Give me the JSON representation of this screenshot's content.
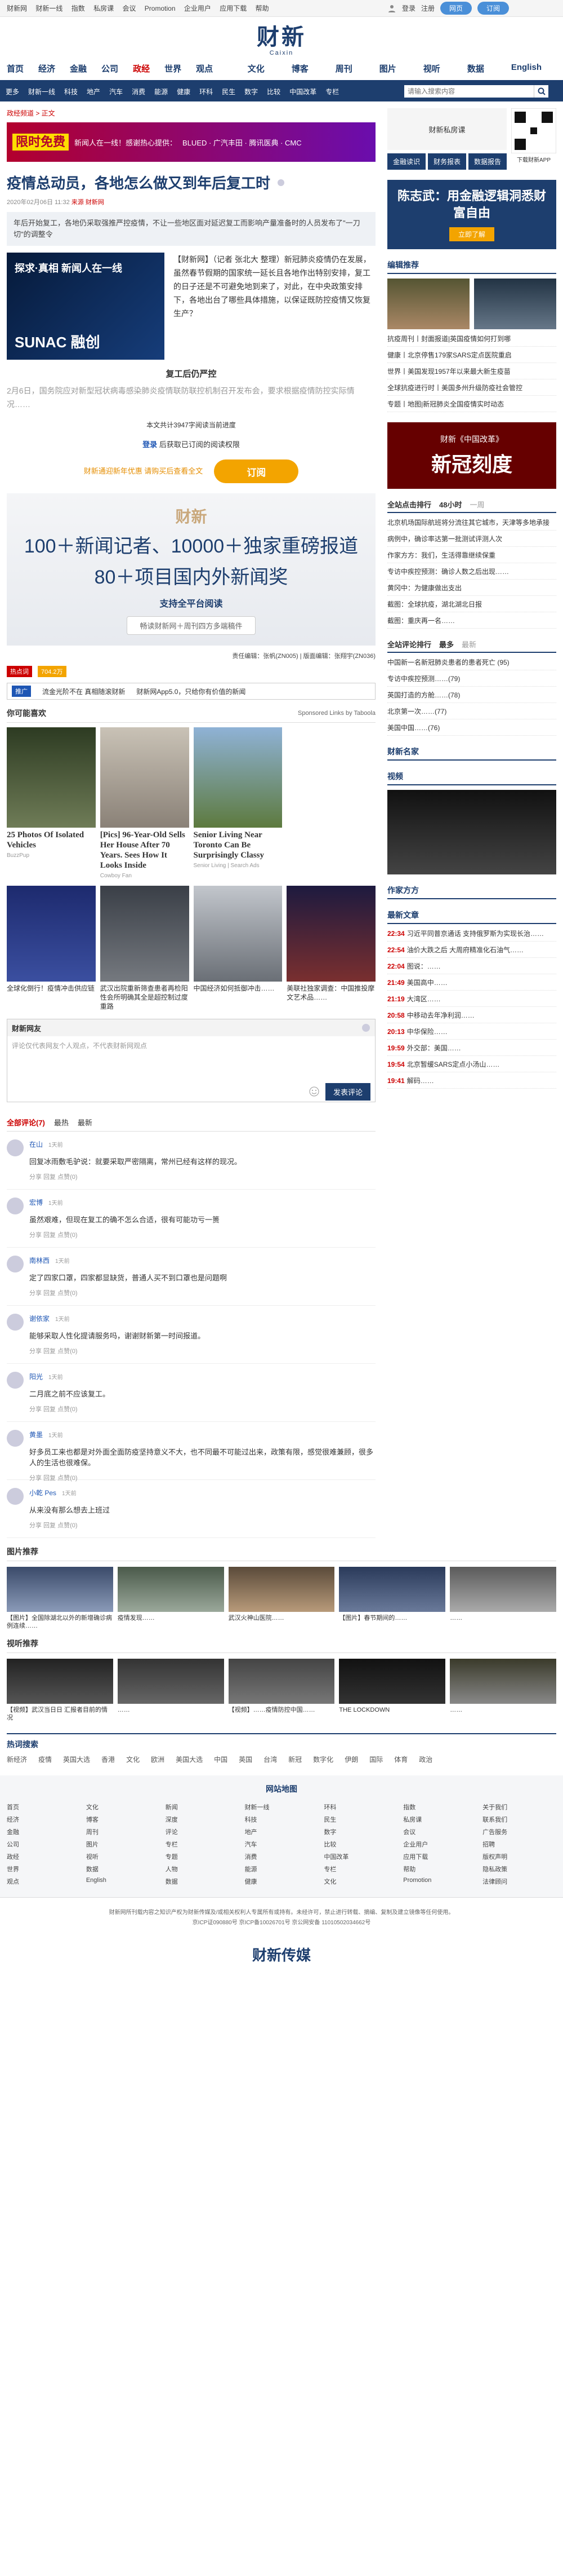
{
  "topbar": {
    "links": [
      "财新网",
      "财新一线",
      "指数",
      "私房课",
      "会议",
      "Promotion",
      "企业用户",
      "应用下载",
      "帮助"
    ],
    "login": "登录",
    "register": "注册",
    "btn1": "网页",
    "btn2": "订阅"
  },
  "logo": {
    "cn": "财新",
    "en": "Caixin"
  },
  "mainnav": {
    "items": [
      "首页",
      "经济",
      "金融",
      "公司",
      "政经",
      "世界",
      "观点"
    ],
    "right": [
      "文化",
      "博客",
      "周刊",
      "图片",
      "视听",
      "数据",
      "English"
    ]
  },
  "subnav": {
    "items": [
      "更多",
      "财新一线",
      "科技",
      "地产",
      "汽车",
      "消费",
      "能源",
      "健康",
      "环科",
      "民生",
      "数字",
      "比较",
      "中国改革",
      "专栏"
    ],
    "search_placeholder": "请输入搜索内容"
  },
  "crumb": "政经频道 > 正文",
  "banner": {
    "big": "限时免费",
    "text": "新闻人在一线！感谢热心提供：",
    "sponsors": "BLUED · 广汽丰田 · 腾讯医典 · CMC"
  },
  "article": {
    "title": "疫情总动员，各地怎么做又到年后复工时",
    "meta_date": "2020年02月06日 11:32",
    "meta_src": "来源 财新网",
    "summary": "年后开始复工，各地仍采取强推严控疫情，不让一些地区面对延迟复工而影响产量准备时的人员发布了\"一刀切\"的调整令",
    "lead_img_text": "探求·真相 新闻人在一线",
    "lead_img_sub": "SUNAC 融创",
    "lead_text": "【财新网】（记者 张北大 整理）新冠肺炎疫情仍在发展，虽然春节假期的国家统一延长且各地作出特别安排，复工的日子还是不可避免地到来了，对此，在中央政策安排下，各地出台了哪些具体措施，以保证既防控疫情又恢复生产？",
    "sub1": "复工后仍严控",
    "para1": "2月6日，国务院应对新型冠状病毒感染肺炎疫情联防联控机制召开发布会，要求根据疫情防控实际情况……",
    "share": "本文共计3947字阅读当前进度",
    "login_prompt": "后获取已订阅的阅读权限",
    "login_link": "登录",
    "pay_sub": "财新通迎新年优惠 请购买后查看全文",
    "pay_btn": "订阅"
  },
  "promo": {
    "logo": "财新",
    "l1": "100＋新闻记者、10000＋独家重磅报道",
    "l2": "80＋项目国内外新闻奖",
    "l3": "支持全平台阅读",
    "cta": "畅读财新网＋周刊四方多端稿件"
  },
  "editor": "责任编辑：张帆(ZN005) | 版面编辑：张翔宇(ZN036)",
  "tags": {
    "t1": "热点词",
    "t2": "704.2万"
  },
  "adstrip": {
    "badge": "推广",
    "a": "流金光阶不在 真相随滚财新",
    "b": "财新网App5.0，只给你有价值的新闻"
  },
  "recommend": {
    "head": "你可能喜欢",
    "sponsored": "Sponsored Links by Taboola",
    "cards": [
      {
        "t": "25 Photos Of Isolated Vehicles",
        "s": "BuzzPup"
      },
      {
        "t": "[Pics] 96-Year-Old Sells Her House After 70 Years. Sees How It Looks Inside",
        "s": "Cowboy Fan"
      },
      {
        "t": "Senior Living Near Toronto Can Be Surprisingly Classy",
        "s": "Senior Living | Search Ads"
      },
      {
        "t": "",
        "s": ""
      }
    ],
    "cards2": [
      {
        "t": "全球化倒行！疫情冲击供应链"
      },
      {
        "t": "武汉出院重新筛查患者再检阳性会所明确其全是超控制过度重路"
      },
      {
        "t": "中国经济如何抵御冲击……"
      },
      {
        "t": "美联社独家调查：中国推投摩文艺术品……"
      }
    ]
  },
  "comment": {
    "head": "财新网友",
    "placeholder": "评论仅代表网友个人观点，不代表财新网观点",
    "send": "发表评论",
    "tabs": [
      "全部评论(7)",
      "最热",
      "最新"
    ],
    "items": [
      {
        "name": "在山",
        "time": "1天前",
        "text": "回复冰雨敷毛驴说：就要采取严密隔离，常州已经有这样的现况。"
      },
      {
        "name": "宏博",
        "time": "1天前",
        "text": "虽然艰难，但现在复工的确不怎么合适，很有可能功亏一篑"
      },
      {
        "name": "南林西",
        "time": "1天前",
        "text": "定了四家口罩，四家都显缺货，普通人买不到口罩也是问题啊"
      },
      {
        "name": "谢依家",
        "time": "1天前",
        "text": "能够采取人性化提请服务吗，谢谢财新第一时间报道。"
      },
      {
        "name": "阳光",
        "time": "1天前",
        "text": "二月底之前不应该复工。"
      },
      {
        "name": "黄墨",
        "time": "1天前",
        "text": "好多员工来也都是对外面全面防疫坚持意义不大，也不同最不可能过出来，政策有限，感觉很难兼顾，很多人的生活也很难保。"
      },
      {
        "name": "小乾 Pes",
        "time": "1天前",
        "text": "从来没有那么想去上班过"
      }
    ],
    "act": "分享 回复 点赞(0)"
  },
  "pictures": {
    "head": "图片推荐",
    "items": [
      {
        "t": "【图片】全国除湖北以外的新增确诊病例连续……"
      },
      {
        "t": "疫情发现……"
      },
      {
        "t": "武汉火神山医院……"
      },
      {
        "t": "【图片】春节期间的……"
      },
      {
        "t": "……"
      }
    ]
  },
  "videos": {
    "head": "视听推荐",
    "items": [
      {
        "t": "【视频】武汉当日日 汇报者目前的情况"
      },
      {
        "t": "……"
      },
      {
        "t": "【视频】……疫情防控中国……"
      },
      {
        "t": "THE LOCKDOWN"
      },
      {
        "t": "……"
      }
    ]
  },
  "sidebar": {
    "qr_caption": "财新私房课",
    "app_label": "下载财新APP",
    "box_labels": [
      "金融读识",
      "财务报表",
      "数据报告"
    ],
    "ad_text": "陈志武：用金融逻辑洞悉财富自由",
    "ad_btn": "立即了解",
    "editor_head": "编辑推荐",
    "editor_list": [
      "抗疫周刊丨封面报道|英国疫情如何打到哪",
      "健康丨北京停售179家SARS定点医院重启",
      "世界丨美国发现1957年以来最大新生疫苗",
      "全球抗疫进行时丨美国多州升级防疫社会管控",
      "专题丨地图|新冠肺炎全国疫情实时动态"
    ],
    "hot_head": "全站点击排行",
    "hot_tabs": [
      "48小时",
      "一周"
    ],
    "hot_list": [
      "北京机场国际航班将分流往其它城市，天津等多地承接",
      "病例中，确诊率达第一批测试评测人次",
      "作家方方：我们，生活得靠继续保重",
      "专访中疾控预测：确诊人数之后出现……",
      "黄冈中：为健康做出支出",
      "截图：全球抗疫，湖北湖北日报",
      "截图：重庆再一名……"
    ],
    "comment_head": "全站评论排行",
    "comment_tabs": [
      "最多",
      "最新"
    ],
    "comment_list": [
      "中国新一名新冠肺炎患者的患者死亡 (95)",
      "专访中疾控预测……(79)",
      "英国打造的方舱……(78)",
      "北京第一次……(77)",
      "美国中国……(76)"
    ],
    "topic_head": "财新名家",
    "video_head": "视频",
    "author_head": "作家方方",
    "news_head": "最新文章",
    "news_list": [
      {
        "time": "22:34",
        "t": "习近平同普京通话 支持俄罗斯为实现长治……"
      },
      {
        "time": "22:54",
        "t": "油价大跌之后 大周府精准化石油气……"
      },
      {
        "time": "22:04",
        "t": "图说：……"
      },
      {
        "time": "21:49",
        "t": "美国高中……"
      },
      {
        "time": "21:19",
        "t": "大湾区……"
      },
      {
        "time": "20:58",
        "t": "中移动去年净利润……"
      },
      {
        "time": "20:13",
        "t": "中华保险……"
      },
      {
        "time": "19:59",
        "t": "外交部：美国……"
      },
      {
        "time": "19:54",
        "t": "北京暂缓SARS定点小汤山……"
      },
      {
        "time": "19:41",
        "t": "解码……"
      }
    ],
    "vote_head": "财新《中国改革》",
    "vote_big": "新冠刻度"
  },
  "footer": {
    "links_head": "热词搜索",
    "links": [
      "新经济",
      "疫情",
      "英国大选",
      "香港",
      "文化",
      "欧洲",
      "美国大选",
      "中国",
      "英国",
      "台湾",
      "新冠",
      "数字化",
      "伊朗",
      "国际",
      "体育",
      "政治"
    ],
    "sitemap_head": "网站地图",
    "sitemap_cols": [
      [
        "首页",
        "经济",
        "金融",
        "公司",
        "政经",
        "世界",
        "观点"
      ],
      [
        "文化",
        "博客",
        "周刊",
        "图片",
        "视听",
        "数据",
        "English"
      ],
      [
        "新闻",
        "深度",
        "评论",
        "专栏",
        "专题",
        "人物",
        "数据"
      ],
      [
        "财新一线",
        "科技",
        "地产",
        "汽车",
        "消费",
        "能源",
        "健康"
      ],
      [
        "环科",
        "民生",
        "数字",
        "比较",
        "中国改革",
        "专栏",
        "文化"
      ],
      [
        "指数",
        "私房课",
        "会议",
        "企业用户",
        "应用下载",
        "帮助",
        "Promotion"
      ],
      [
        "关于我们",
        "联系我们",
        "广告服务",
        "招聘",
        "版权声明",
        "隐私政策",
        "法律顾问"
      ]
    ],
    "copyright": "财新网所刊载内容之知识产权为财新传媒及/或相关权利人专属所有或持有。未经许可，禁止进行转载、摘编、复制及建立镜像等任何使用。",
    "copyright2": "京ICP证090880号 京ICP备10026701号 京公网安备 11010502034662号",
    "brand": "财新传媒"
  }
}
